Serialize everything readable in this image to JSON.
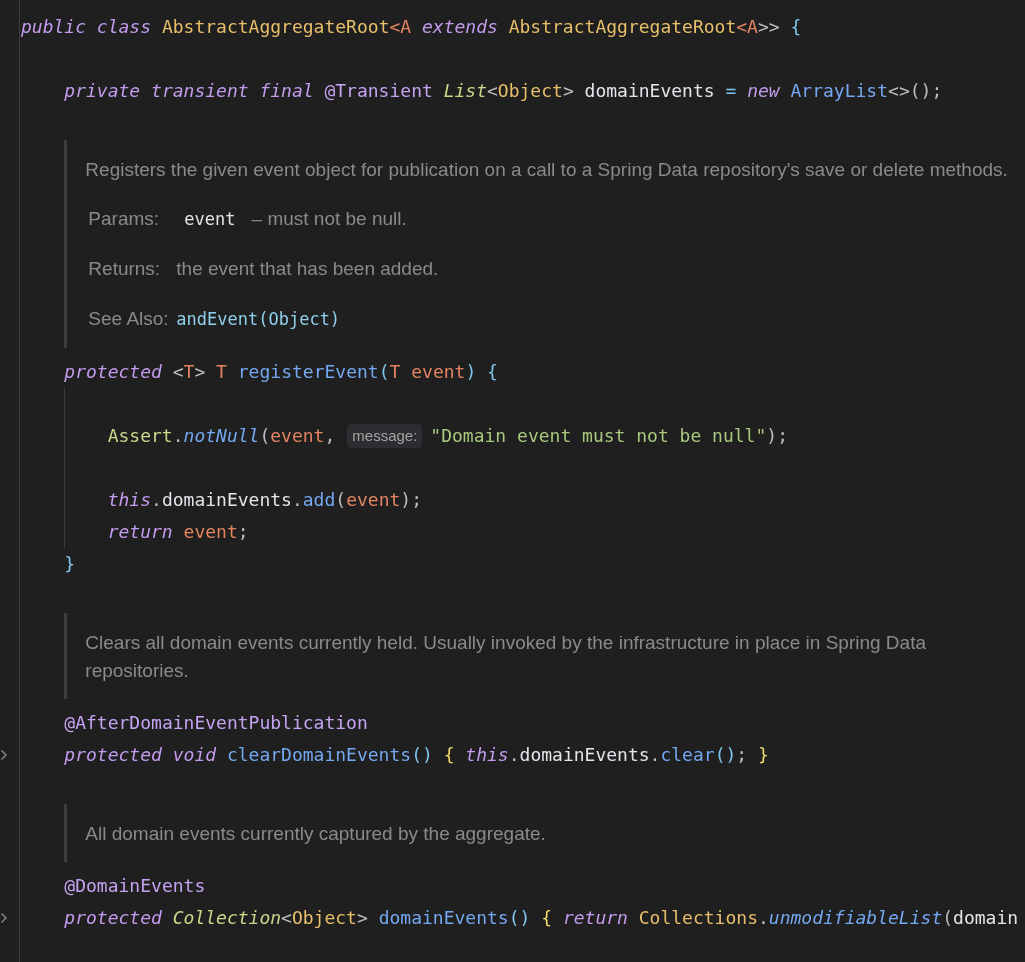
{
  "editor": {
    "lines": [
      {
        "kind": "code",
        "folded": false,
        "segments": [
          {
            "kind": "code",
            "tokens": [
              {
                "kind": "keyword",
                "text": "public class "
              },
              {
                "kind": "class",
                "text": "AbstractAggregateRoot"
              },
              {
                "kind": "typeparam",
                "text": "<A "
              },
              {
                "kind": "keyword",
                "text": "extends "
              },
              {
                "kind": "class",
                "text": "AbstractAggregateRoot"
              },
              {
                "kind": "typeparam",
                "text": "<A"
              },
              {
                "kind": "plain",
                "text": ">> "
              },
              {
                "kind": "bracket",
                "text": "{"
              }
            ]
          }
        ],
        "children": [
          {
            "kind": "blank"
          },
          {
            "kind": "code",
            "folded": false,
            "segments": [
              {
                "kind": "code",
                "tokens": [
                  {
                    "kind": "keyword",
                    "text": "private transient final "
                  },
                  {
                    "kind": "annotation",
                    "text": "@Transient "
                  },
                  {
                    "kind": "iface",
                    "text": "List"
                  },
                  {
                    "kind": "plain",
                    "text": "<"
                  },
                  {
                    "kind": "class",
                    "text": "Object"
                  },
                  {
                    "kind": "plain",
                    "text": "> "
                  },
                  {
                    "kind": "field",
                    "text": "domainEvents"
                  },
                  {
                    "kind": "op",
                    "text": " = "
                  },
                  {
                    "kind": "keyword",
                    "text": "new "
                  },
                  {
                    "kind": "method",
                    "text": "ArrayList"
                  },
                  {
                    "kind": "plain",
                    "text": "<>();"
                  }
                ]
              }
            ]
          },
          {
            "kind": "doc",
            "paragraph": "Registers the given event object for publication on a call to a Spring Data repository's save or delete methods.",
            "tags": [
              {
                "label": "Params:",
                "parts": [
                  {
                    "kind": "code",
                    "text": "event"
                  },
                  {
                    "kind": "text",
                    "text": "– must not be null."
                  }
                ]
              },
              {
                "label": "Returns:",
                "parts": [
                  {
                    "kind": "text",
                    "text": "the event that has been added."
                  }
                ]
              },
              {
                "label": "See Also:",
                "parts": [
                  {
                    "kind": "link",
                    "text": "andEvent(Object)"
                  }
                ]
              }
            ]
          },
          {
            "kind": "code",
            "folded": false,
            "segments": [
              {
                "kind": "code",
                "tokens": [
                  {
                    "kind": "keyword",
                    "text": "protected "
                  },
                  {
                    "kind": "plain",
                    "text": "<"
                  },
                  {
                    "kind": "typeparam",
                    "text": "T"
                  },
                  {
                    "kind": "plain",
                    "text": "> "
                  },
                  {
                    "kind": "typeparam",
                    "text": "T "
                  },
                  {
                    "kind": "method",
                    "text": "registerEvent"
                  },
                  {
                    "kind": "bracket",
                    "text": "("
                  },
                  {
                    "kind": "typeparam",
                    "text": "T "
                  },
                  {
                    "kind": "param",
                    "text": "event"
                  },
                  {
                    "kind": "bracket",
                    "text": ") {"
                  }
                ]
              }
            ],
            "children": [
              {
                "kind": "blank"
              },
              {
                "kind": "code",
                "folded": false,
                "segments": [
                  {
                    "kind": "code",
                    "tokens": [
                      {
                        "kind": "util",
                        "text": "Assert"
                      },
                      {
                        "kind": "plain",
                        "text": "."
                      },
                      {
                        "kind": "methodi",
                        "text": "notNull"
                      },
                      {
                        "kind": "plain",
                        "text": "("
                      },
                      {
                        "kind": "param",
                        "text": "event"
                      },
                      {
                        "kind": "plain",
                        "text": ","
                      }
                    ]
                  },
                  {
                    "kind": "hint",
                    "text": "message:"
                  },
                  {
                    "kind": "code",
                    "tokens": [
                      {
                        "kind": "string",
                        "text": "\"Domain event must not be null\""
                      },
                      {
                        "kind": "plain",
                        "text": ");"
                      }
                    ]
                  }
                ]
              },
              {
                "kind": "blank"
              },
              {
                "kind": "code",
                "folded": false,
                "segments": [
                  {
                    "kind": "code",
                    "tokens": [
                      {
                        "kind": "keyword",
                        "text": "this"
                      },
                      {
                        "kind": "plain",
                        "text": "."
                      },
                      {
                        "kind": "field",
                        "text": "domainEvents"
                      },
                      {
                        "kind": "plain",
                        "text": "."
                      },
                      {
                        "kind": "method",
                        "text": "add"
                      },
                      {
                        "kind": "plain",
                        "text": "("
                      },
                      {
                        "kind": "param",
                        "text": "event"
                      },
                      {
                        "kind": "plain",
                        "text": ");"
                      }
                    ]
                  }
                ]
              },
              {
                "kind": "code",
                "folded": false,
                "segments": [
                  {
                    "kind": "code",
                    "tokens": [
                      {
                        "kind": "keyword",
                        "text": "return "
                      },
                      {
                        "kind": "param",
                        "text": "event"
                      },
                      {
                        "kind": "plain",
                        "text": ";"
                      }
                    ]
                  }
                ]
              }
            ]
          },
          {
            "kind": "code",
            "folded": false,
            "segments": [
              {
                "kind": "code",
                "tokens": [
                  {
                    "kind": "bracket",
                    "text": "}"
                  }
                ]
              }
            ]
          },
          {
            "kind": "doc",
            "paragraph": "Clears all domain events currently held. Usually invoked by the infrastructure in place in Spring Data repositories."
          },
          {
            "kind": "code",
            "folded": false,
            "segments": [
              {
                "kind": "code",
                "tokens": [
                  {
                    "kind": "annotation",
                    "text": "@AfterDomainEventPublication"
                  }
                ]
              }
            ]
          },
          {
            "kind": "code",
            "folded": true,
            "segments": [
              {
                "kind": "code",
                "tokens": [
                  {
                    "kind": "keyword",
                    "text": "protected void "
                  },
                  {
                    "kind": "method",
                    "text": "clearDomainEvents"
                  },
                  {
                    "kind": "bracket",
                    "text": "() "
                  },
                  {
                    "kind": "bracket2",
                    "text": "{ "
                  },
                  {
                    "kind": "keyword",
                    "text": "this"
                  },
                  {
                    "kind": "plain",
                    "text": "."
                  },
                  {
                    "kind": "field",
                    "text": "domainEvents"
                  },
                  {
                    "kind": "plain",
                    "text": "."
                  },
                  {
                    "kind": "method",
                    "text": "clear"
                  },
                  {
                    "kind": "bracket",
                    "text": "()"
                  },
                  {
                    "kind": "plain",
                    "text": "; "
                  },
                  {
                    "kind": "bracket2",
                    "text": "}"
                  }
                ]
              }
            ]
          },
          {
            "kind": "doc",
            "paragraph": "All domain events currently captured by the aggregate."
          },
          {
            "kind": "code",
            "folded": false,
            "segments": [
              {
                "kind": "code",
                "tokens": [
                  {
                    "kind": "annotation",
                    "text": "@DomainEvents"
                  }
                ]
              }
            ]
          },
          {
            "kind": "code",
            "folded": true,
            "segments": [
              {
                "kind": "code",
                "tokens": [
                  {
                    "kind": "keyword",
                    "text": "protected "
                  },
                  {
                    "kind": "iface",
                    "text": "Collection"
                  },
                  {
                    "kind": "plain",
                    "text": "<"
                  },
                  {
                    "kind": "class",
                    "text": "Object"
                  },
                  {
                    "kind": "plain",
                    "text": "> "
                  },
                  {
                    "kind": "method",
                    "text": "domainEvents"
                  },
                  {
                    "kind": "bracket",
                    "text": "() "
                  },
                  {
                    "kind": "bracket2",
                    "text": "{ "
                  },
                  {
                    "kind": "keyword",
                    "text": "return "
                  },
                  {
                    "kind": "class",
                    "text": "Collections"
                  },
                  {
                    "kind": "plain",
                    "text": "."
                  },
                  {
                    "kind": "methodi",
                    "text": "unmodifiableList"
                  },
                  {
                    "kind": "plain",
                    "text": "("
                  },
                  {
                    "kind": "field",
                    "text": "domain"
                  }
                ]
              }
            ]
          }
        ]
      }
    ]
  }
}
